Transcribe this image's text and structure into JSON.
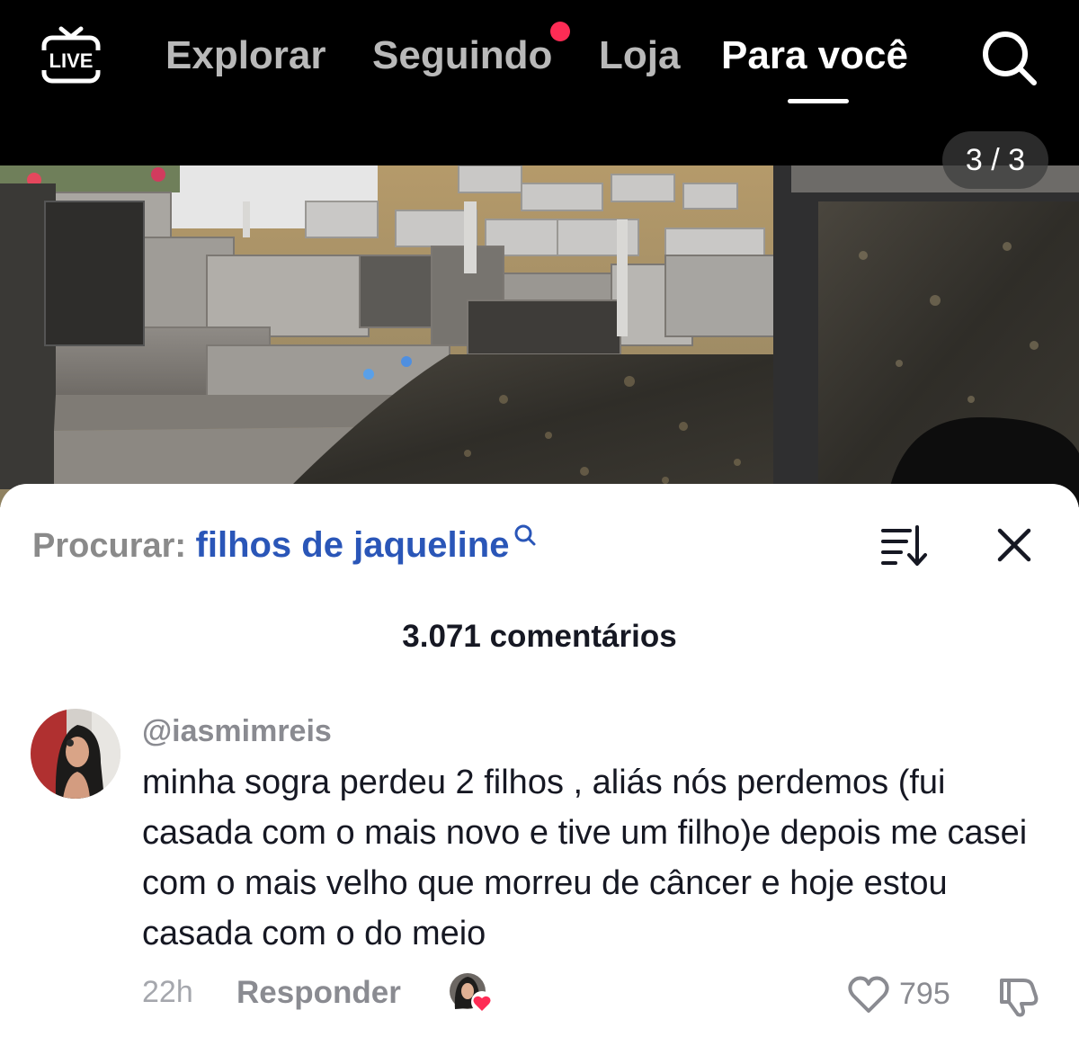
{
  "nav": {
    "live_label": "LIVE",
    "tabs": [
      {
        "label": "Explorar"
      },
      {
        "label": "Seguindo"
      },
      {
        "label": "Loja"
      },
      {
        "label": "Para você"
      }
    ],
    "active_tab": "Para você",
    "search_icon": "search-icon"
  },
  "photo": {
    "page_counter": "3 / 3"
  },
  "comments": {
    "search_label": "Procurar:",
    "search_query": "filhos de jaqueline",
    "count_label": "3.071 comentários",
    "items": [
      {
        "username": "@iasmimreis",
        "text": "minha sogra perdeu 2 filhos , aliás nós perdemos (fui casada com o mais novo e tive um filho)e depois me casei com o mais velho que morreu de câncer e hoje estou casada com o do meio",
        "time": "22h",
        "reply_label": "Responder",
        "likes": "795"
      }
    ]
  },
  "colors": {
    "accent_red": "#fe2c55",
    "link_blue": "#2a56b8",
    "muted_text": "#8a8b91"
  }
}
